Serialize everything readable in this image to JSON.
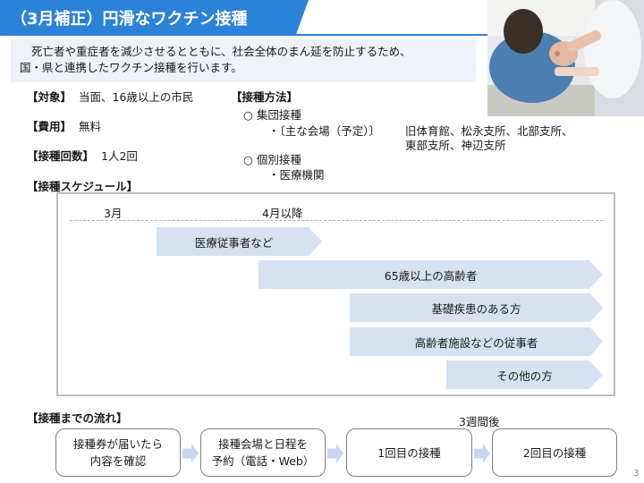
{
  "header": {
    "title": "（3月補正）円滑なワクチン接種"
  },
  "intro": {
    "line1": "死亡者や重症者を減少させるとともに、社会全体のまん延を防止するため、",
    "line2": "国・県と連携したワクチン接種を行います。"
  },
  "target": {
    "label": "【対象】",
    "value": "当面、16歳以上の市民"
  },
  "cost": {
    "label": "【費用】",
    "value": "無料"
  },
  "count": {
    "label": "【接種回数】",
    "value": "1人2回"
  },
  "method": {
    "label": "【接種方法】",
    "group": "○ 集団接種",
    "venue_label": "・〔主な会場（予定）〕",
    "venues_line1": "旧体育館、松永支所、北部支所、",
    "venues_line2": "東部支所、神辺支所",
    "individual": "○ 個別接種",
    "clinic": "・医療機関"
  },
  "schedule": {
    "label": "【接種スケジュール】",
    "month_march": "3月",
    "month_april": "4月以降",
    "bars": [
      {
        "label": "医療従事者など"
      },
      {
        "label": "65歳以上の高齢者"
      },
      {
        "label": "基礎疾患のある方"
      },
      {
        "label": "高齢者施設などの従事者"
      },
      {
        "label": "その他の方"
      }
    ]
  },
  "flow": {
    "label": "【接種までの流れ】",
    "interval": "3週間後",
    "steps": [
      {
        "line1": "接種券が届いたら",
        "line2": "内容を確認"
      },
      {
        "line1": "接種会場と日程を",
        "line2": "予約（電話・Web）"
      },
      {
        "line1": "1回目の接種",
        "line2": ""
      },
      {
        "line1": "2回目の接種",
        "line2": ""
      }
    ]
  },
  "page": {
    "number": "3"
  },
  "colors": {
    "accent": "#2b82d9",
    "bar": "#d6e1f1",
    "intro_bg": "#eef1f7"
  }
}
